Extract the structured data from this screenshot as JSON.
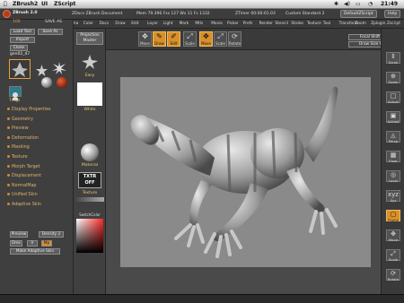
{
  "topbar": {
    "apple": "",
    "app_name": "ZBrush2",
    "menu_ui": "UI",
    "menu_zscript": "ZScript",
    "clock": "21:49"
  },
  "subbar": {
    "app_version": "ZBrush 2.0",
    "doc_name": "ZDocs ZBrush Document",
    "stats": "Mem 79.396  Fss 127  Ws 11  Fs 1332",
    "ztime": "ZTimer 00:00:01.03",
    "custom": "Custom Standard 2",
    "default_zscript": "DefaultZScript",
    "help": "Help",
    "counter_small": "100",
    "saveas_small": "SAVE AS"
  },
  "menus": [
    "Alpha",
    "Color",
    "Docs",
    "Draw",
    "Edit",
    "Layer",
    "Light",
    "Mark",
    "Mtls",
    "Movie",
    "Picker",
    "Prefs",
    "Render",
    "Stencil",
    "Stroke",
    "Texture",
    "Tool",
    "Transform",
    "Zoom",
    "Zplugin",
    "Zscript"
  ],
  "left": {
    "load_tool": "Load Tool",
    "save_as": "Save As",
    "import": "Import",
    "export": "Export",
    "clone": "Clone",
    "tool_name": "gen02_47",
    "tool_count": "47",
    "texture_lbl": "Tmgs",
    "sections": [
      "Display Properties",
      "Geometry",
      "Preview",
      "Deformation",
      "Masking",
      "Texture",
      "Morph Target",
      "Displacement",
      "NormalMap",
      "Unified Skin",
      "Adaptive Skin"
    ],
    "preview_btn": "Preview",
    "density_lbl": "Density 2",
    "dres_lbl": "Dres",
    "ir_lbl": "Ir",
    "mp_lbl": "Mp",
    "make_skin": "Make Adaptive Skin"
  },
  "strip": {
    "projection_master": "Projection Master",
    "easy_lbl": "Easy",
    "white_lbl": "White",
    "material_lbl": "Material",
    "texture_off": "TXTR OFF",
    "texture_lbl": "Texture",
    "switch_lbl": "SwitchColor",
    "color_lbl": "SwitchColor"
  },
  "toolbar": {
    "buttons": [
      "Move",
      "Scale",
      "Rotate",
      "Draw",
      "Edit",
      "Move",
      "Scale",
      "Rotate"
    ],
    "focal": "Focal Shift 0",
    "draw_size": "Draw Size 64"
  },
  "rightbar": [
    "Scroll",
    "Zoom",
    "Actual",
    "AAHalf",
    "Persp",
    "Floor",
    "Local",
    "Xyz",
    "Frame",
    "Move",
    "Scale",
    "Rotate"
  ],
  "colors": {
    "accent": "#d8902a",
    "panel": "#3f3f3f",
    "canvas": "#8a8a8a"
  }
}
